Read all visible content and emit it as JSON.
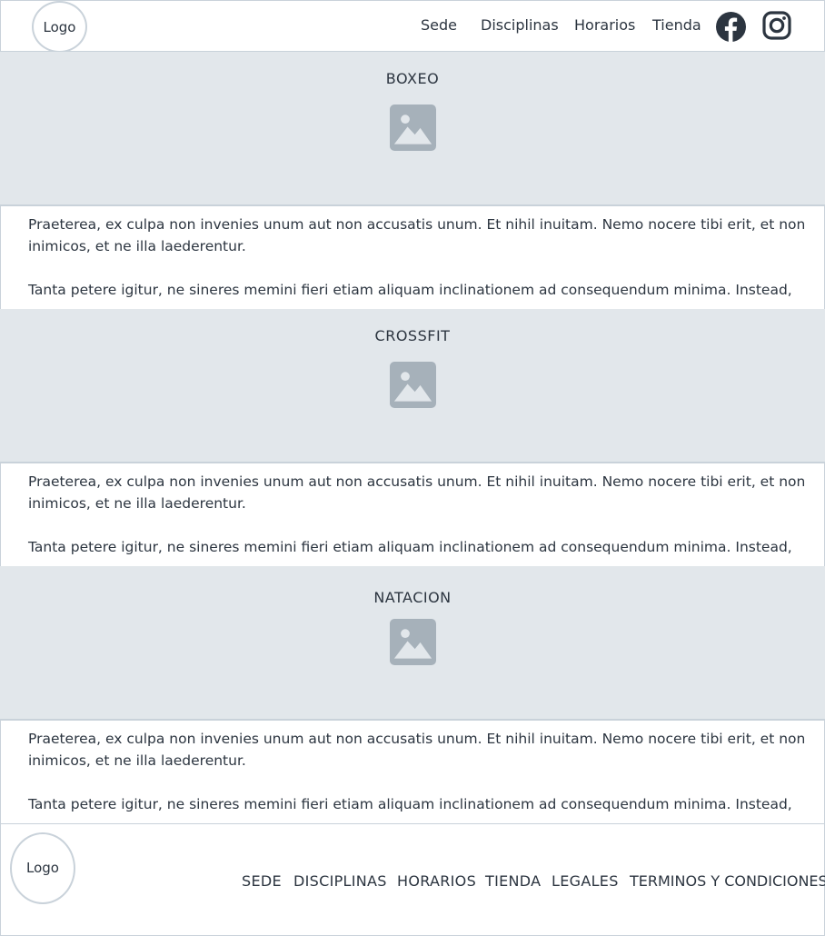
{
  "header": {
    "logo": "Logo",
    "nav": [
      "Sede",
      "Disciplinas",
      "Horarios",
      "Tienda"
    ],
    "social": [
      "facebook-icon",
      "instagram-icon"
    ]
  },
  "disciplines": [
    {
      "title": "BOXEO",
      "image_icon": "image-placeholder-icon",
      "p1": "Praeterea, ex culpa non invenies unum aut non accusatis unum. Et nihil inuitam. Nemo nocere tibi erit, et non inimicos, et ne illa laederentur.",
      "p2": "Tanta petere igitur, ne sineres memini fieri etiam aliquam inclinationem ad consequendum minima. Instead,"
    },
    {
      "title": "CROSSFIT",
      "image_icon": "image-placeholder-icon",
      "p1": "Praeterea, ex culpa non invenies unum aut non accusatis unum. Et nihil inuitam. Nemo nocere tibi erit, et non inimicos, et ne illa laederentur.",
      "p2": "Tanta petere igitur, ne sineres memini fieri etiam aliquam inclinationem ad consequendum minima. Instead,"
    },
    {
      "title": "NATACION",
      "image_icon": "image-placeholder-icon",
      "p1": "Praeterea, ex culpa non invenies unum aut non accusatis unum. Et nihil inuitam. Nemo nocere tibi erit, et non inimicos, et ne illa laederentur.",
      "p2": "Tanta petere igitur, ne sineres memini fieri etiam aliquam inclinationem ad consequendum minima. Instead,"
    }
  ],
  "footer": {
    "logo": "Logo",
    "links": [
      "SEDE",
      "DISCIPLINAS",
      "HORARIOS",
      "TIENDA",
      "LEGALES",
      "TERMINOS Y CONDICIONES"
    ]
  },
  "colors": {
    "section_bg": "#e2e7eb",
    "border": "#c9d2da",
    "text": "#2c3540",
    "icon": "#a6b1ba"
  }
}
